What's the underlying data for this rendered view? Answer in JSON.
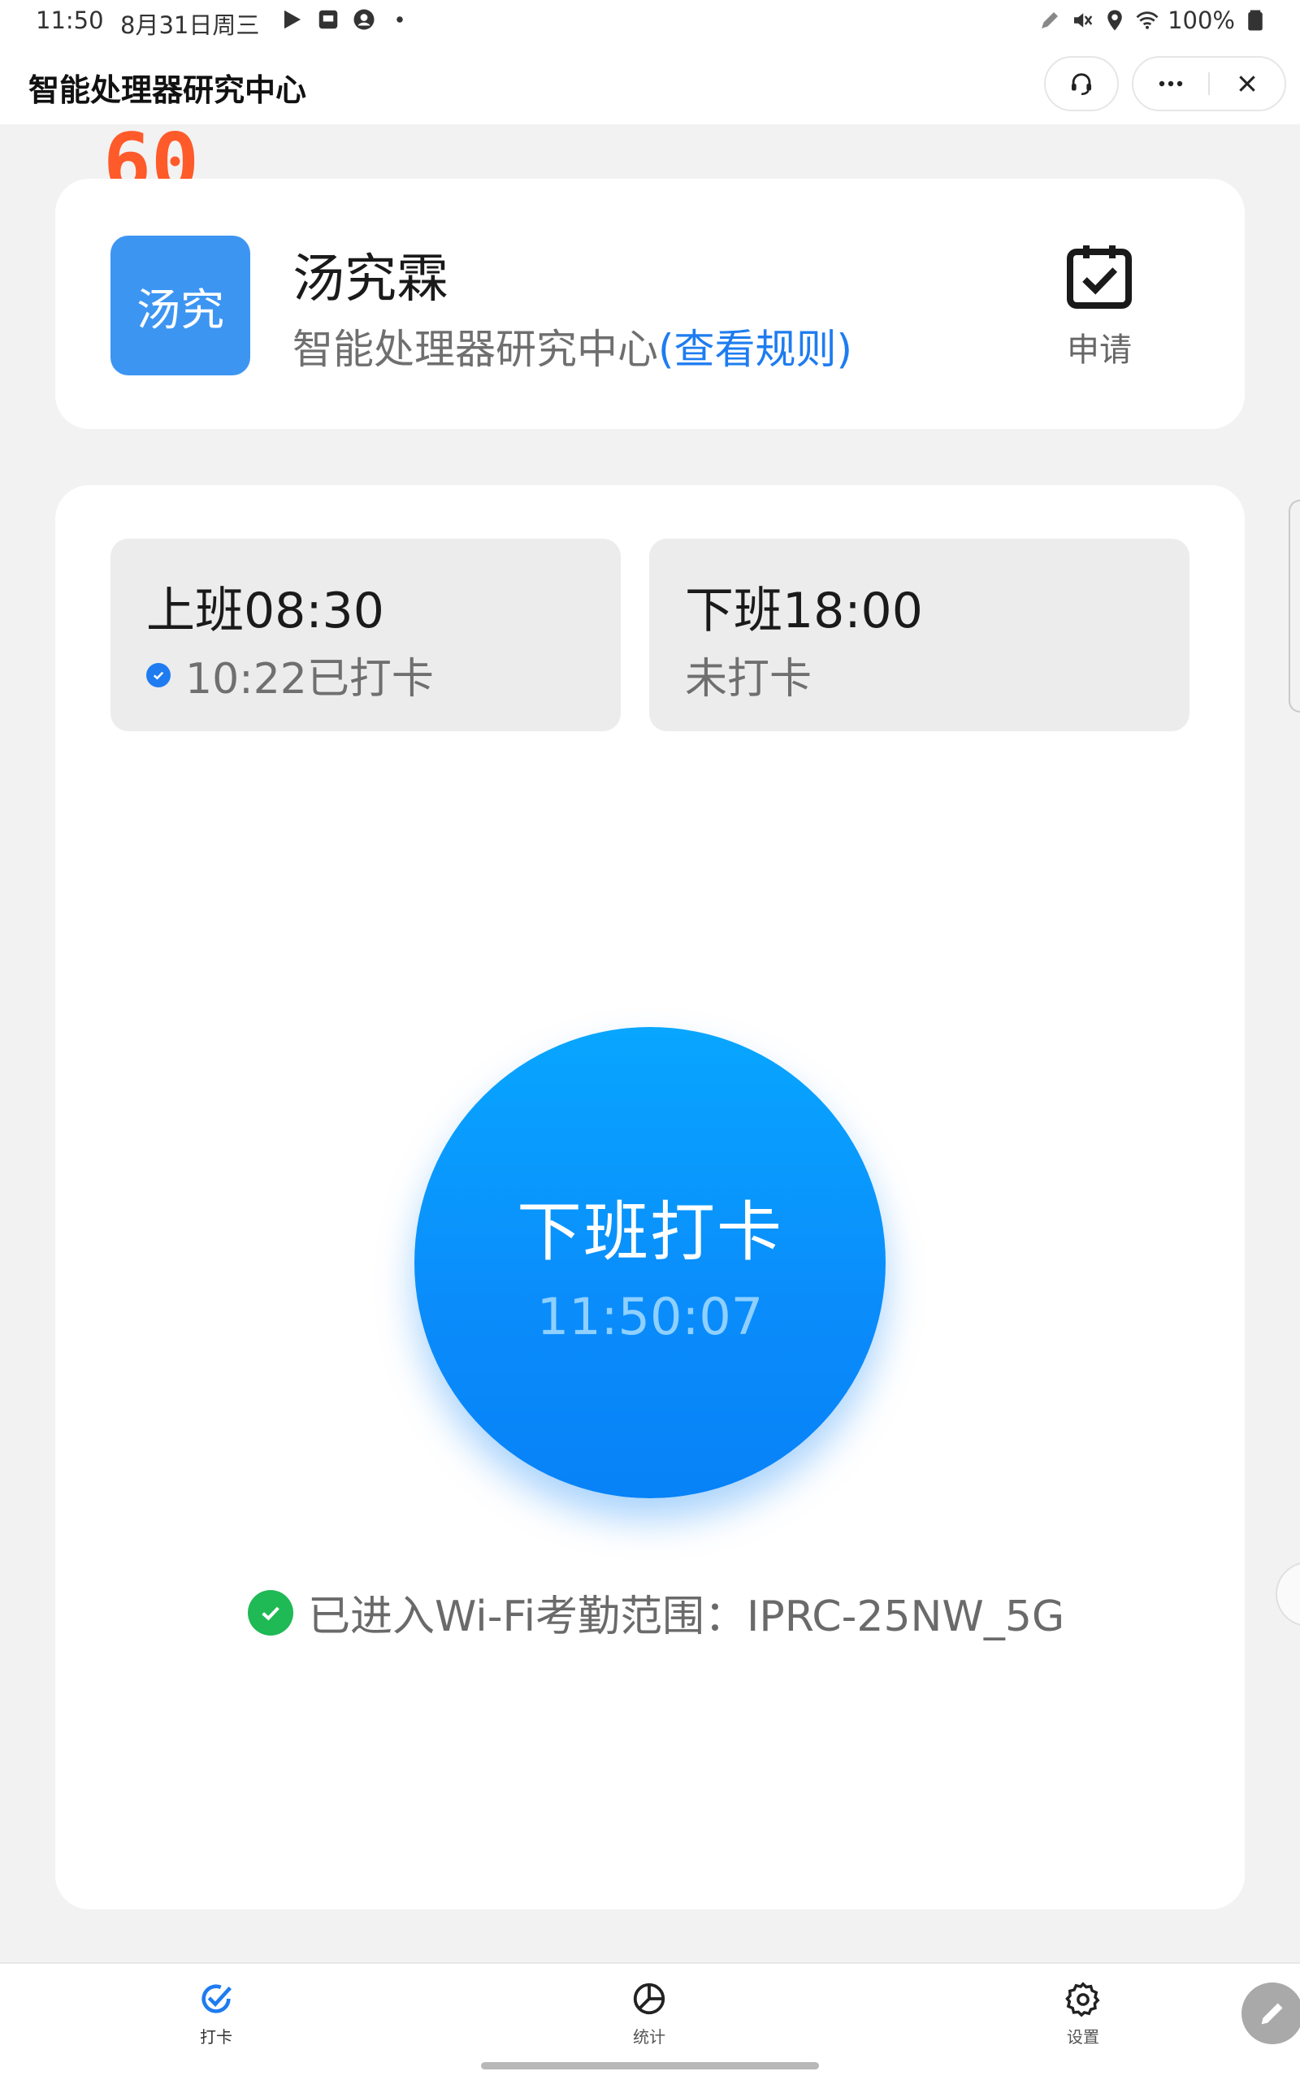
{
  "status_bar": {
    "time": "11:50",
    "date": "8月31日周三",
    "battery": "100%"
  },
  "titlebar": {
    "title": "智能处理器研究中心"
  },
  "badge": "60",
  "user": {
    "avatar_text": "汤究",
    "name": "汤究霖",
    "department": "智能处理器研究中心",
    "rules_link": "(查看规则)",
    "apply_label": "申请"
  },
  "shifts": {
    "on": {
      "title": "上班08:30",
      "status": "10:22已打卡"
    },
    "off": {
      "title": "下班18:00",
      "status": "未打卡"
    }
  },
  "punch": {
    "label": "下班打卡",
    "time": "11:50:07"
  },
  "wifi_status": "已进入Wi-Fi考勤范围：IPRC-25NW_5G",
  "bottom_nav": {
    "punch": "打卡",
    "stats": "统计",
    "settings": "设置"
  },
  "colors": {
    "accent": "#1e7cf0",
    "punch_button": "#0a8cfb",
    "avatar": "#3d95f2",
    "ok_green": "#1fb955",
    "badge": "#ff5a2a"
  }
}
